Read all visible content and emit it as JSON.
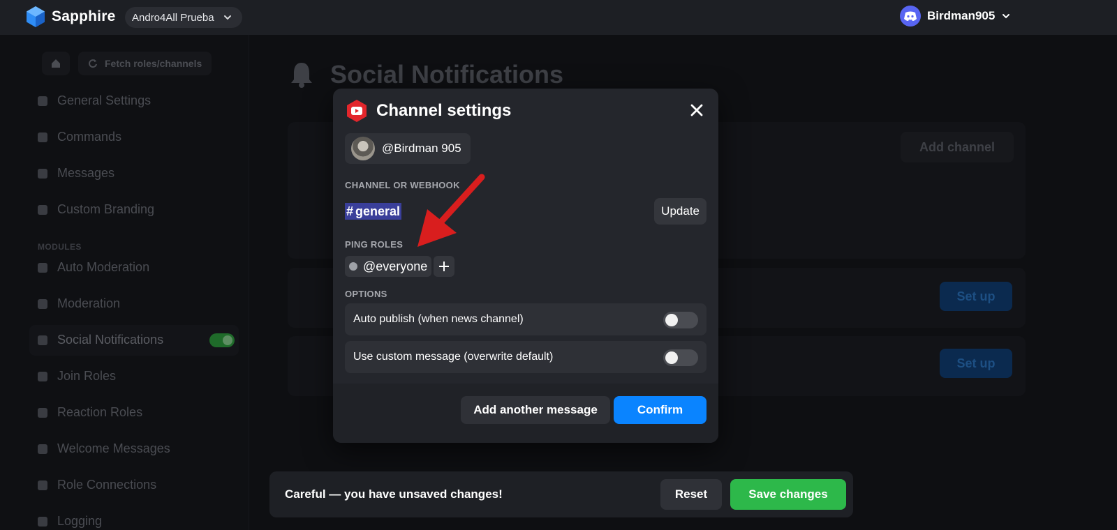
{
  "topbar": {
    "app_name": "Sapphire",
    "server_name": "Andro4All Prueba",
    "username": "Birdman905"
  },
  "sidebar": {
    "fetch_label": "Fetch roles/channels",
    "section_modules": "MODULES",
    "items": [
      {
        "label": "General Settings"
      },
      {
        "label": "Commands"
      },
      {
        "label": "Messages"
      },
      {
        "label": "Custom Branding"
      },
      {
        "label": "Auto Moderation"
      },
      {
        "label": "Moderation"
      },
      {
        "label": "Social Notifications"
      },
      {
        "label": "Join Roles"
      },
      {
        "label": "Reaction Roles"
      },
      {
        "label": "Welcome Messages"
      },
      {
        "label": "Role Connections"
      },
      {
        "label": "Logging"
      }
    ]
  },
  "page": {
    "title": "Social Notifications",
    "add_channel": "Add channel",
    "setup_label": "Set up"
  },
  "modal": {
    "title": "Channel settings",
    "account": "@Birdman 905",
    "channel_label": "CHANNEL OR WEBHOOK",
    "channel_value": "general",
    "channel_prefix": "#",
    "update_label": "Update",
    "ping_label": "PING ROLES",
    "ping_role": "@everyone",
    "options_label": "OPTIONS",
    "options": [
      {
        "label": "Auto publish (when news channel)",
        "enabled": false
      },
      {
        "label": "Use custom message (overwrite default)",
        "enabled": false
      }
    ],
    "add_message_label": "Add another message",
    "confirm_label": "Confirm"
  },
  "unsaved": {
    "message": "Careful — you have unsaved changes!",
    "reset_label": "Reset",
    "save_label": "Save changes"
  },
  "colors": {
    "accent_blue": "#0a84ff",
    "save_green": "#2db84a",
    "youtube_red": "#e3262c",
    "discord_blurple": "#5865f2",
    "arrow_red": "#d91e1e"
  }
}
